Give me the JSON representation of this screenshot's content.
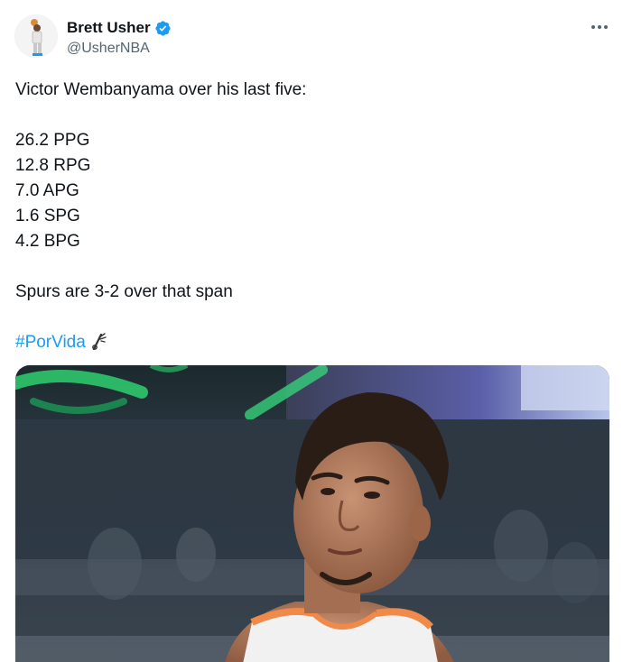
{
  "author": {
    "display_name": "Brett Usher",
    "handle": "@UsherNBA",
    "verified": true
  },
  "tweet": {
    "intro": "Victor Wembanyama over his last five:",
    "stats": [
      "26.2 PPG",
      "12.8 RPG",
      "7.0 APG",
      "1.6 SPG",
      "4.2 BPG"
    ],
    "record": "Spurs are 3-2 over that span",
    "hashtag": "#PorVida",
    "emoji": "spurs-emoji"
  },
  "media": {
    "type": "photo",
    "subject": "basketball-player-photo"
  },
  "colors": {
    "text": "#0f1419",
    "secondary": "#536471",
    "link": "#1d9bf0",
    "verified": "#1d9bf0"
  },
  "icons": {
    "verified": "verified-badge-icon",
    "more": "more-options-icon"
  }
}
